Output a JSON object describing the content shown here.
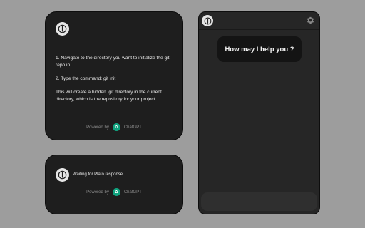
{
  "answer_card": {
    "paragraphs": [
      "1. Navigate to the directory you want to initialize the git repo in.",
      "2. Type the command: git init",
      "This will create a hidden .git directory in the current directory, which is the repository for your project."
    ],
    "powered_by": "Powered by",
    "provider": "ChatGPT"
  },
  "waiting_card": {
    "status": "Waiting for Plato response...",
    "powered_by": "Powered by",
    "provider": "ChatGPT"
  },
  "chat_panel": {
    "greeting": "How may I help you ?",
    "input_value": "",
    "input_placeholder": ""
  },
  "icons": {
    "logo": "plato-logo-icon",
    "provider": "openai-icon",
    "settings": "gear-icon"
  },
  "colors": {
    "background": "#9d9d9d",
    "card": "#1e1e1e",
    "panel": "#262626",
    "bubble": "#141414",
    "provider_badge": "#10a37f"
  }
}
